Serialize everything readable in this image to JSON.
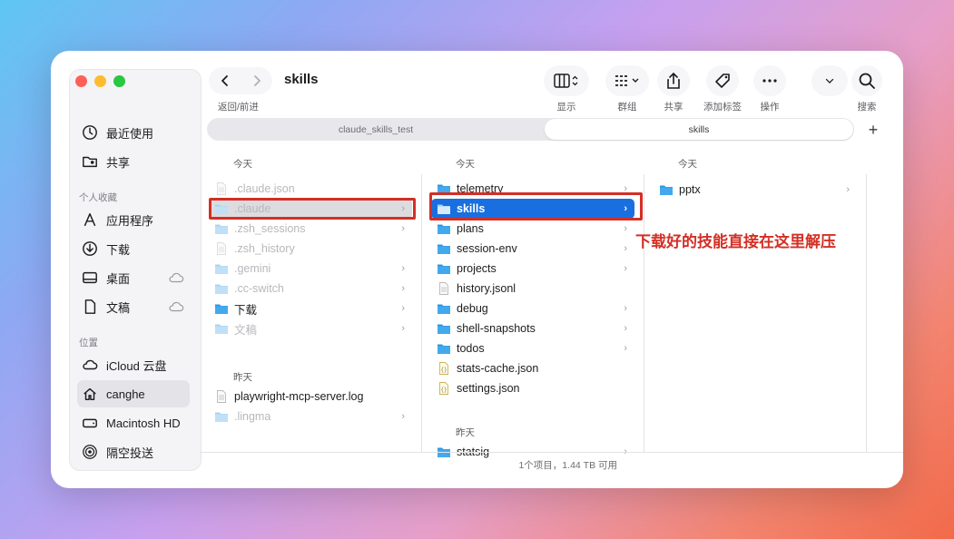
{
  "window": {
    "title": "skills",
    "nav_caption": "返回/前进"
  },
  "toolbar": {
    "view_label": "显示",
    "group_label": "群组",
    "share_label": "共享",
    "tag_label": "添加标签",
    "action_label": "操作",
    "search_label": "搜索"
  },
  "tabs": [
    {
      "label": "claude_skills_test",
      "active": false
    },
    {
      "label": "skills",
      "active": true
    }
  ],
  "sidebar": {
    "items_top": [
      {
        "label": "最近使用",
        "icon": "clock-icon"
      },
      {
        "label": "共享",
        "icon": "shared-folder-icon"
      }
    ],
    "favorites_heading": "个人收藏",
    "favorites": [
      {
        "label": "应用程序",
        "icon": "applications-icon"
      },
      {
        "label": "下载",
        "icon": "download-icon"
      },
      {
        "label": "桌面",
        "icon": "desktop-icon",
        "cloud": true
      },
      {
        "label": "文稿",
        "icon": "document-icon",
        "cloud": true
      }
    ],
    "locations_heading": "位置",
    "locations": [
      {
        "label": "iCloud 云盘",
        "icon": "icloud-icon"
      },
      {
        "label": "canghe",
        "icon": "home-icon",
        "selected": true
      },
      {
        "label": "Macintosh HD",
        "icon": "hard-drive-icon"
      },
      {
        "label": "隔空投送",
        "icon": "airdrop-icon"
      }
    ]
  },
  "columns": {
    "col1": {
      "today_heading": "今天",
      "items": [
        {
          "name": ".claude.json",
          "type": "file",
          "dim": true
        },
        {
          "name": ".claude",
          "type": "folder",
          "dim": true,
          "highlight": true,
          "chevron": true
        },
        {
          "name": ".zsh_sessions",
          "type": "folder",
          "dim": true,
          "chevron": true
        },
        {
          "name": ".zsh_history",
          "type": "file",
          "dim": true
        },
        {
          "name": ".gemini",
          "type": "folder",
          "dim": true,
          "chevron": true
        },
        {
          "name": ".cc-switch",
          "type": "folder",
          "dim": true,
          "chevron": true
        },
        {
          "name": "下载",
          "type": "folder",
          "chevron": true
        },
        {
          "name": "文稿",
          "type": "folder",
          "dim": true,
          "chevron": true
        }
      ],
      "yesterday_heading": "昨天",
      "yesterday_items": [
        {
          "name": "playwright-mcp-server.log",
          "type": "file"
        },
        {
          "name": ".lingma",
          "type": "folder",
          "dim": true,
          "chevron": true
        }
      ]
    },
    "col2": {
      "today_heading": "今天",
      "items": [
        {
          "name": "telemetry",
          "type": "folder",
          "chevron": true
        },
        {
          "name": "skills",
          "type": "folder",
          "selected": true,
          "chevron": true
        },
        {
          "name": "plans",
          "type": "folder",
          "chevron": true
        },
        {
          "name": "session-env",
          "type": "folder",
          "chevron": true
        },
        {
          "name": "projects",
          "type": "folder",
          "chevron": true
        },
        {
          "name": "history.jsonl",
          "type": "file"
        },
        {
          "name": "debug",
          "type": "folder",
          "chevron": true
        },
        {
          "name": "shell-snapshots",
          "type": "folder",
          "chevron": true
        },
        {
          "name": "todos",
          "type": "folder",
          "chevron": true
        },
        {
          "name": "stats-cache.json",
          "type": "json"
        },
        {
          "name": "settings.json",
          "type": "json"
        }
      ],
      "yesterday_heading": "昨天",
      "yesterday_items": [
        {
          "name": "statsig",
          "type": "folder",
          "chevron": true
        }
      ]
    },
    "col3": {
      "today_heading": "今天",
      "items": [
        {
          "name": "pptx",
          "type": "folder",
          "chevron": true
        }
      ]
    }
  },
  "status_text": "1个项目，1.44 TB 可用",
  "annotation": "下载好的技能直接在这里解压",
  "colors": {
    "accent": "#1a6fe0",
    "annotation": "#d32f25"
  }
}
